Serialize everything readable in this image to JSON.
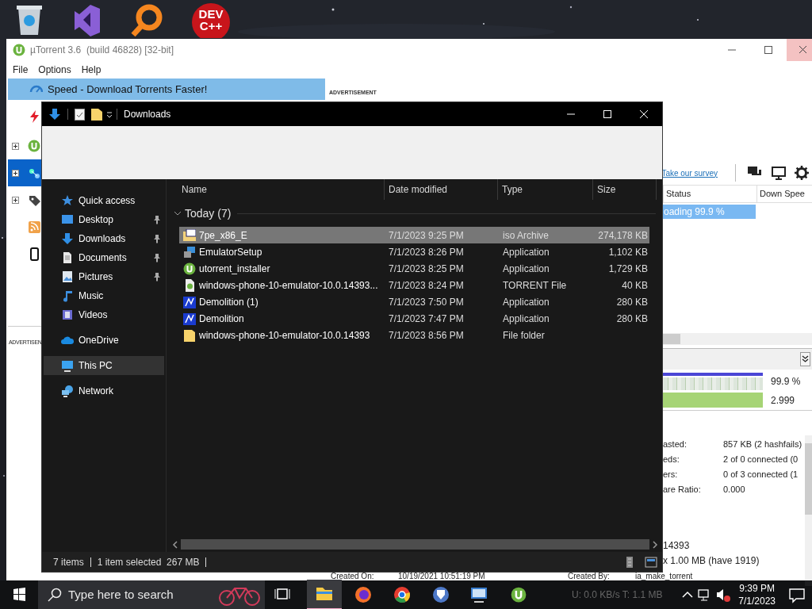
{
  "desktop_icons": [
    {
      "kind": "recycle"
    },
    {
      "kind": "studio"
    },
    {
      "kind": "search"
    },
    {
      "kind": "devcpp",
      "lines": [
        "DEV",
        "C++"
      ]
    }
  ],
  "utorrent": {
    "title": "µTorrent 3.6  (build 46828) [32-bit]",
    "menu": [
      "File",
      "Options",
      "Help"
    ],
    "sidebar": [
      {
        "kind": "speed",
        "label": "Speed - Download Torrents Faster!",
        "selected": true
      },
      {
        "kind": "bolt",
        "selected": false
      },
      {
        "kind": "torrents",
        "selected": false
      },
      {
        "kind": "feeds",
        "selected": true
      },
      {
        "kind": "labels",
        "selected": false
      },
      {
        "kind": "rss",
        "selected": false
      },
      {
        "kind": "device",
        "selected": false
      }
    ],
    "ad_top": "ADVERTISEMENT",
    "ad_side": "ADVERTISEN",
    "survey_link": "Take our survey",
    "columns": [
      "Status",
      "Down Spee"
    ],
    "rows": [
      {
        "status": "oading 99.9 %",
        "selected": true
      }
    ],
    "downloaded": {
      "level": 0.999,
      "reading": "99.9 %"
    },
    "availability": {
      "level": 1,
      "reading": "2.999"
    },
    "info": [
      {
        "label": "asted:",
        "value": "857 KB (2 hashfails)"
      },
      {
        "label": "eds:",
        "value": "2 of 0 connected (0"
      },
      {
        "label": "ers:",
        "value": "0 of 3 connected (1"
      },
      {
        "label": "are Ratio:",
        "value": "0.000"
      }
    ],
    "general": [
      "14393",
      "x 1.00 MB (have 1919)"
    ],
    "created": [
      {
        "label": "Created On:",
        "value": "10/19/2021 10:51:19 PM"
      },
      {
        "label": "Created By:",
        "value": "ia_make_torrent"
      }
    ],
    "status_bar": "U: 0.0 KB/s T: 1.1 MB"
  },
  "explorer": {
    "title": "Downloads",
    "nav": [
      {
        "kind": "star",
        "label": "Quick access",
        "pinned": false,
        "selected": false
      },
      {
        "kind": "desktop",
        "label": "Desktop",
        "pinned": true,
        "selected": false
      },
      {
        "kind": "downloads",
        "label": "Downloads",
        "pinned": true,
        "selected": false
      },
      {
        "kind": "documents",
        "label": "Documents",
        "pinned": true,
        "selected": false
      },
      {
        "kind": "pictures",
        "label": "Pictures",
        "pinned": true,
        "selected": false
      },
      {
        "kind": "music",
        "label": "Music",
        "pinned": false,
        "selected": false
      },
      {
        "kind": "videos",
        "label": "Videos",
        "pinned": false,
        "selected": false
      },
      {
        "kind": "onedrive",
        "label": "OneDrive",
        "pinned": false,
        "selected": false
      },
      {
        "kind": "pc",
        "label": "This PC",
        "pinned": false,
        "selected": true
      },
      {
        "kind": "network",
        "label": "Network",
        "pinned": false,
        "selected": false
      }
    ],
    "columns": [
      "Name",
      "Date modified",
      "Type",
      "Size"
    ],
    "group": "Today (7)",
    "files": [
      {
        "kind": "iso",
        "name": "7pe_x86_E",
        "date": "7/1/2023 9:25 PM",
        "type": "iso Archive",
        "size": "274,178 KB",
        "selected": true
      },
      {
        "kind": "setup",
        "name": "EmulatorSetup",
        "date": "7/1/2023 8:26 PM",
        "type": "Application",
        "size": "1,102 KB",
        "selected": false
      },
      {
        "kind": "utorrent",
        "name": "utorrent_installer",
        "date": "7/1/2023 8:25 PM",
        "type": "Application",
        "size": "1,729 KB",
        "selected": false
      },
      {
        "kind": "torrent",
        "name": "windows-phone-10-emulator-10.0.14393...",
        "date": "7/1/2023 8:24 PM",
        "type": "TORRENT File",
        "size": "40 KB",
        "selected": false
      },
      {
        "kind": "app",
        "name": "Demolition (1)",
        "date": "7/1/2023 7:50 PM",
        "type": "Application",
        "size": "280 KB",
        "selected": false
      },
      {
        "kind": "app",
        "name": "Demolition",
        "date": "7/1/2023 7:47 PM",
        "type": "Application",
        "size": "280 KB",
        "selected": false
      },
      {
        "kind": "folder",
        "name": "windows-phone-10-emulator-10.0.14393",
        "date": "7/1/2023 8:56 PM",
        "type": "File folder",
        "selected": false
      }
    ],
    "status": [
      "7 items",
      "1 item selected  267 MB"
    ]
  },
  "taskbar": {
    "search": {
      "placeholder": "Type here to search"
    },
    "apps": [
      {
        "kind": "taskview",
        "active": false
      },
      {
        "kind": "explorer",
        "active": true
      },
      {
        "kind": "firefox",
        "active": false
      },
      {
        "kind": "chrome",
        "active": false
      },
      {
        "kind": "brave",
        "active": false
      },
      {
        "kind": "remote",
        "active": false
      },
      {
        "kind": "utorrent",
        "active": false
      }
    ],
    "time": "9:39 PM",
    "date": "7/1/2023"
  }
}
